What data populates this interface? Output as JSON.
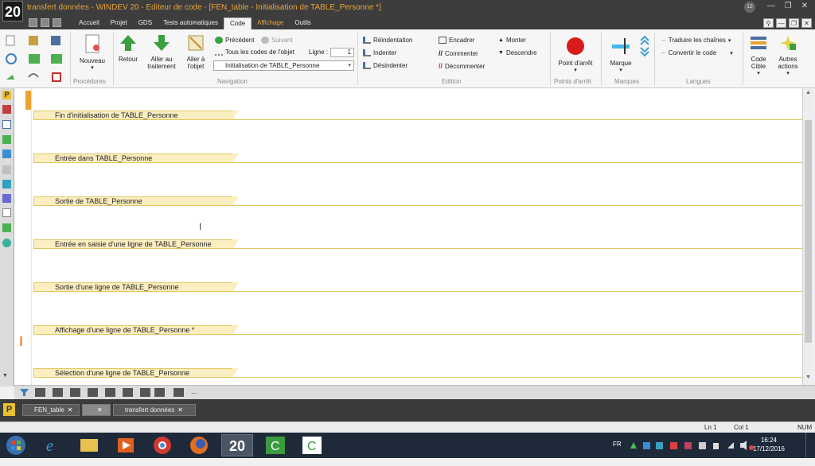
{
  "window": {
    "logo": "20",
    "title": "transfert données - WINDEV 20 - Editeur de code - [FEN_table - Initialisation de TABLE_Personne *]",
    "notif_count": "12"
  },
  "menu": {
    "items": [
      "Accueil",
      "Projet",
      "GDS",
      "Tests automatiques",
      "Code",
      "Affichage",
      "Outils"
    ]
  },
  "ribbon": {
    "nouveau": "Nouveau",
    "procedures": "Procédures",
    "retour": "Retour",
    "aller_traitement": "Aller au traitement",
    "aller_objet": "Aller à l'objet",
    "precedent": "Précédent",
    "suivant": "Suivant",
    "tous_codes": "Tous les codes de l'objet",
    "ligne_label": "Ligne :",
    "ligne_value": "1",
    "combo_value": "Initialisation de TABLE_Personne",
    "navigation": "Navigation",
    "reindentation": "Réindentation",
    "indenter": "Indenter",
    "desindenter": "Désindenter",
    "encadrer": "Encadrer",
    "commenter": "Commenter",
    "decommenter": "Décommenter",
    "monter": "Monter",
    "descendre": "Descendre",
    "edition": "Edition",
    "point_arret": "Point d'arrêt",
    "points_arret": "Points d'arrêt",
    "marque": "Marque",
    "marques": "Marques",
    "traduire": "Traduire les chaînes",
    "convertir": "Convertir le code",
    "langues": "Langues",
    "code_cible": "Code Cible",
    "autres_actions": "Autres actions"
  },
  "sections": [
    "Fin d'initialisation de TABLE_Personne",
    "Entrée dans TABLE_Personne",
    "Sortie de TABLE_Personne",
    "Entrée en saisie d'une ligne de TABLE_Personne",
    "Sortie d'une ligne de TABLE_Personne",
    "Affichage d'une ligne de TABLE_Personne *",
    "Sélection d'une ligne de TABLE_Personne"
  ],
  "bottom_toolbar": {
    "more": "..."
  },
  "doc_tabs": {
    "logo": "P",
    "tab1": "FEN_table",
    "tab3": "transfert données"
  },
  "status": {
    "ln": "Ln 1",
    "col": "Col 1",
    "num": "NUM"
  },
  "taskbar": {
    "app_label": "20",
    "lang": "FR",
    "time": "16:24",
    "date": "17/12/2016"
  },
  "colors": {
    "accent_orange": "#e8a33c",
    "section_bg": "#fbeec0",
    "taskbar_bg": "#1e2a3a"
  }
}
